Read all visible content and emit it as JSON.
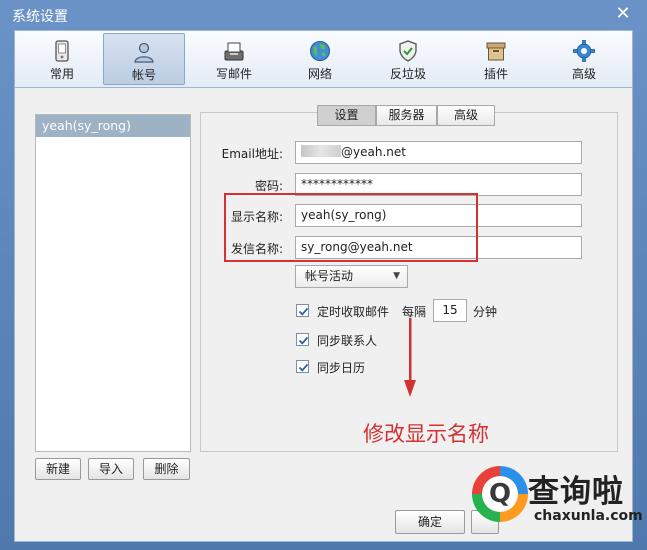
{
  "window": {
    "title": "系统设置"
  },
  "toolbar": {
    "items": [
      {
        "label": "常用",
        "icon": "phone-icon"
      },
      {
        "label": "帐号",
        "icon": "user-icon"
      },
      {
        "label": "写邮件",
        "icon": "compose-icon"
      },
      {
        "label": "网络",
        "icon": "globe-icon"
      },
      {
        "label": "反垃圾",
        "icon": "shield-icon"
      },
      {
        "label": "插件",
        "icon": "box-icon"
      },
      {
        "label": "高级",
        "icon": "gear-icon"
      }
    ],
    "active": "帐号"
  },
  "accounts": {
    "items": [
      "yeah(sy_rong)"
    ],
    "new_label": "新建",
    "import_label": "导入",
    "delete_label": "删除"
  },
  "tabs": {
    "items": [
      "设置",
      "服务器",
      "高级"
    ],
    "active": "设置"
  },
  "form": {
    "email_label": "Email地址:",
    "email_value_suffix": "@yeah.net",
    "password_label": "密码:",
    "password_value": "************",
    "display_name_label": "显示名称:",
    "display_name_value": "yeah(sy_rong)",
    "sender_name_label": "发信名称:",
    "sender_name_value": "sy_rong@yeah.net",
    "activity_dropdown": "帐号活动",
    "auto_fetch_label": "定时收取邮件",
    "every_label": "每隔",
    "interval_value": "15",
    "minutes_label": "分钟",
    "sync_contacts_label": "同步联系人",
    "sync_calendar_label": "同步日历"
  },
  "footer": {
    "ok_label": "确定"
  },
  "annotation": {
    "text": "修改显示名称"
  },
  "watermark": {
    "cn": "查询啦",
    "en": "chaxunla.com"
  },
  "colors": {
    "accent_red": "#d23232",
    "title_bg": "#5d83b5",
    "list_selected": "#9eb2c6"
  }
}
